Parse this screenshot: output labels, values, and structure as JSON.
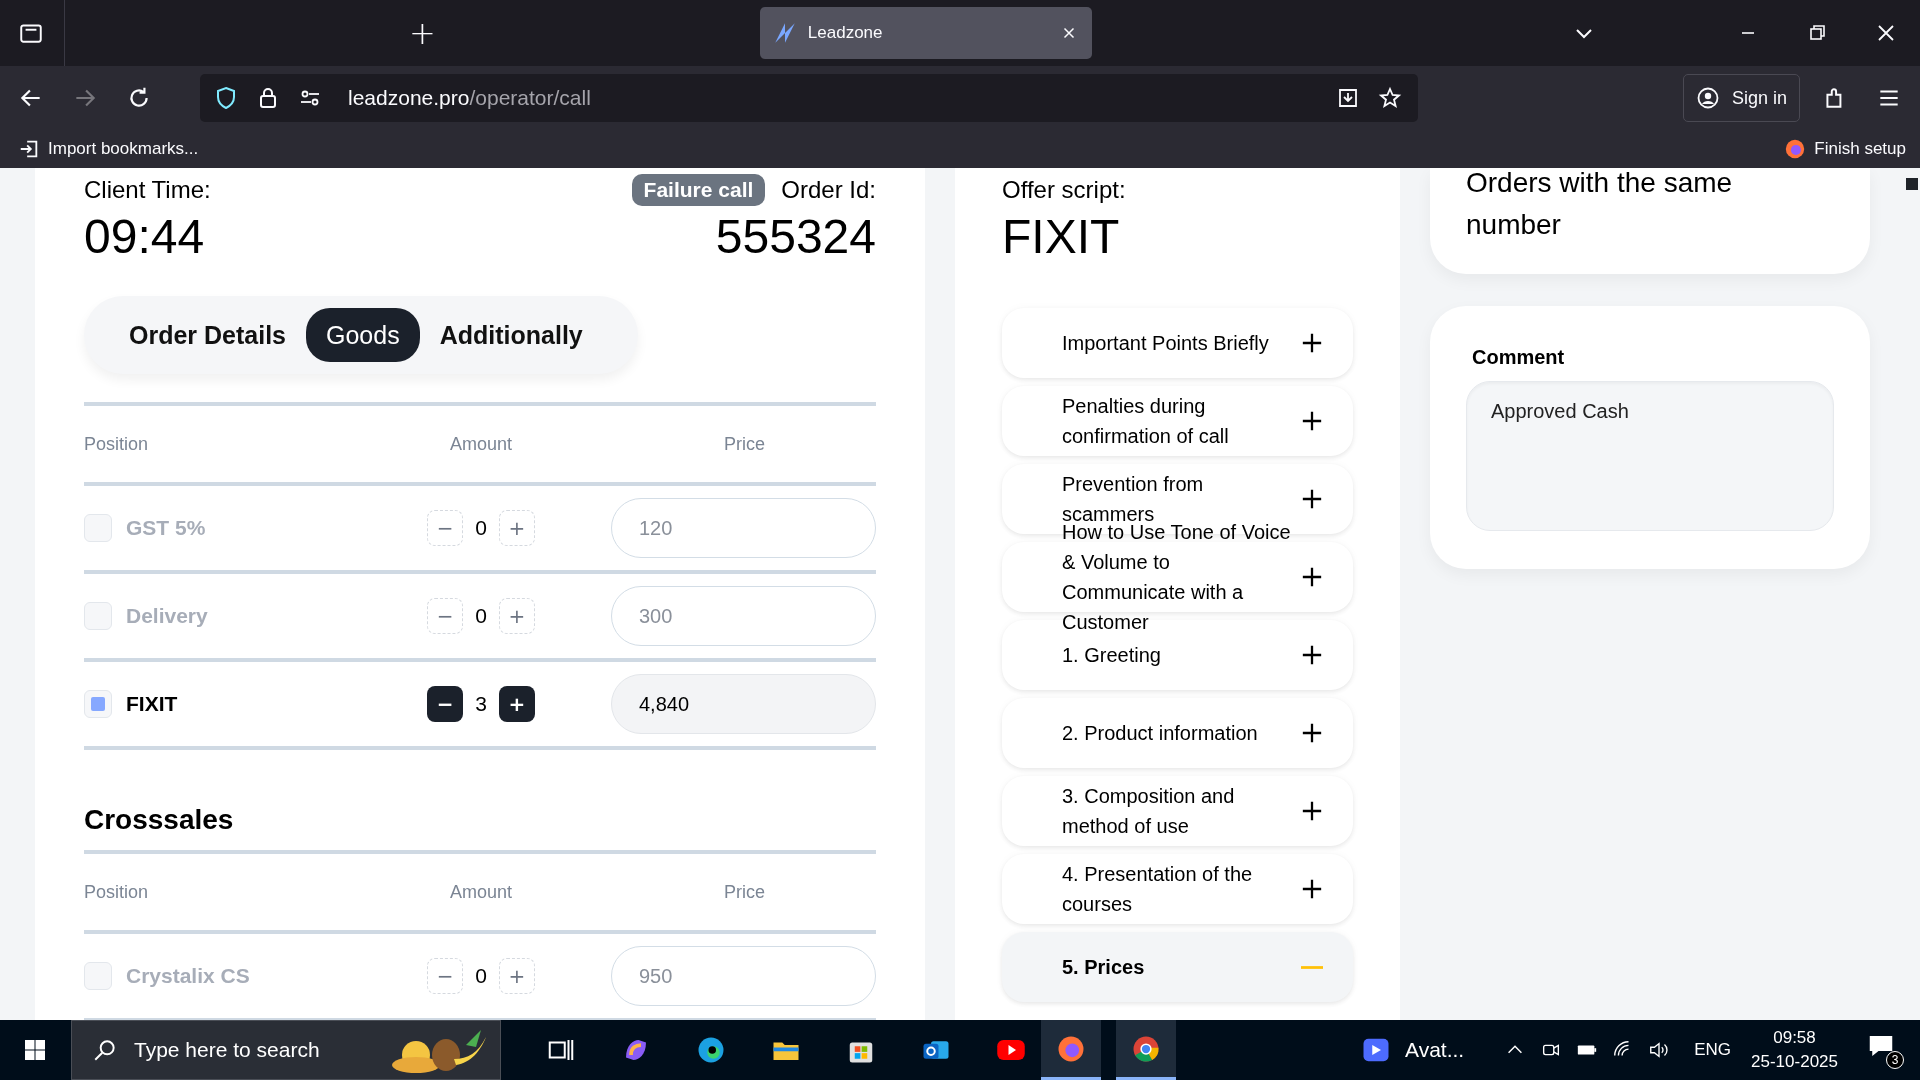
{
  "browser": {
    "tab_title": "Leadzone",
    "new_tab": "+",
    "url_host": "leadzone.pro",
    "url_path": "/operator/call",
    "sign_in": "Sign in",
    "import_bookmarks": "Import bookmarks...",
    "finish_setup": "Finish setup"
  },
  "order": {
    "client_time_label": "Client Time:",
    "client_time": "09:44",
    "status_badge": "Failure call",
    "order_id_label": "Order Id:",
    "order_id": "555324"
  },
  "tabs": [
    {
      "label": "Order Details",
      "selected": false
    },
    {
      "label": "Goods",
      "selected": true
    },
    {
      "label": "Additionally",
      "selected": false
    }
  ],
  "goods": {
    "columns": [
      "Position",
      "Amount",
      "Price"
    ],
    "rows": [
      {
        "name": "GST 5%",
        "checked": false,
        "minus": "−",
        "amount": "0",
        "plus": "+",
        "price": "120"
      },
      {
        "name": "Delivery",
        "checked": false,
        "minus": "−",
        "amount": "0",
        "plus": "+",
        "price": "300"
      },
      {
        "name": "FIXIT",
        "checked": true,
        "minus": "−",
        "amount": "3",
        "plus": "+",
        "price": "4,840"
      }
    ]
  },
  "crosssales": {
    "title": "Crosssales",
    "columns": [
      "Position",
      "Amount",
      "Price"
    ],
    "rows": [
      {
        "name": "Crystalix CS",
        "checked": false,
        "minus": "−",
        "amount": "0",
        "plus": "+",
        "price": "950"
      }
    ]
  },
  "script": {
    "label": "Offer script:",
    "title": "FIXIT",
    "items": [
      {
        "label": "Important Points Briefly",
        "expanded": false
      },
      {
        "label": "Penalties during confirmation of call",
        "expanded": false
      },
      {
        "label": "Prevention from scammers",
        "expanded": false
      },
      {
        "label": "How to Use Tone of Voice & Volume to Communicate with a Customer",
        "expanded": false
      },
      {
        "label": "1. Greeting",
        "expanded": false
      },
      {
        "label": "2. Product information",
        "expanded": false
      },
      {
        "label": "3. Composition and method of use",
        "expanded": false
      },
      {
        "label": "4. Presentation of the courses",
        "expanded": false
      },
      {
        "label": "5. Prices",
        "expanded": true
      }
    ]
  },
  "orders_same_number": {
    "title": "Orders with the same number"
  },
  "comment": {
    "label": "Comment",
    "value": "Approved Cash"
  },
  "taskbar": {
    "search_placeholder": "Type here to search",
    "app_label": "Avat...",
    "language": "ENG",
    "time": "09:58",
    "date": "25-10-2025",
    "notifications": "3"
  }
}
